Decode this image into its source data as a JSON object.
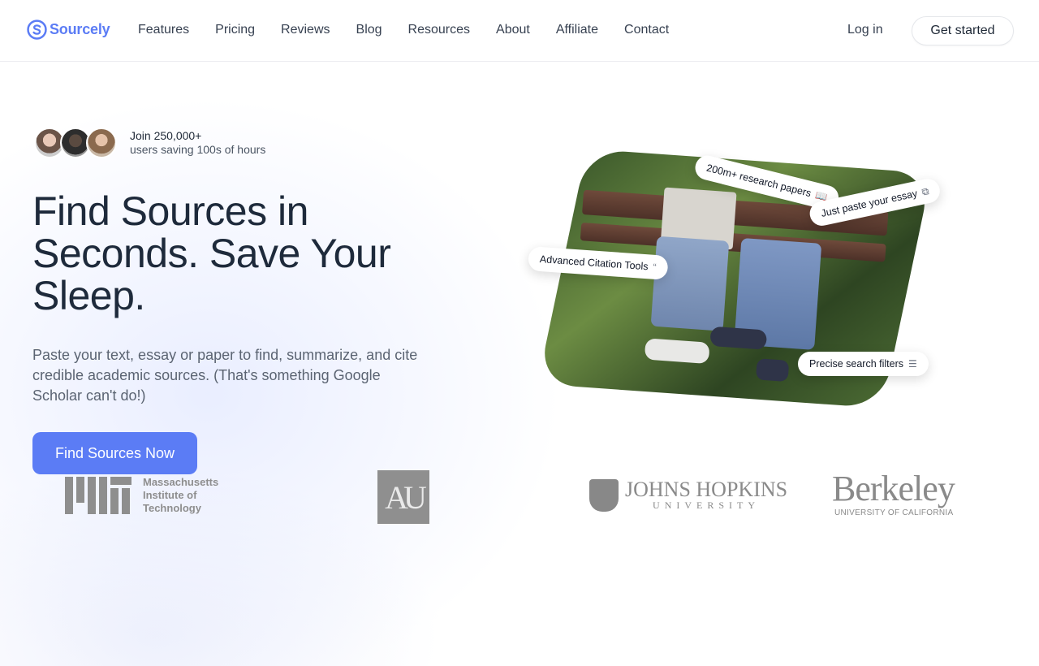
{
  "nav": {
    "brand": "Sourcely",
    "links": [
      "Features",
      "Pricing",
      "Reviews",
      "Blog",
      "Resources",
      "About",
      "Affiliate",
      "Contact"
    ],
    "login": "Log in",
    "get_started": "Get started"
  },
  "hero": {
    "social_proof_line1": "Join 250,000+",
    "social_proof_line2": "users saving 100s of hours",
    "headline": "Find Sources in Seconds. Save Your Sleep.",
    "subheadline": "Paste your text, essay or paper to find, summarize, and cite credible academic sources. (That's something Google Scholar can't do!)",
    "cta": "Find Sources Now",
    "tags": {
      "research_papers": "200m+ research papers",
      "paste_essay": "Just paste your essay",
      "citation_tools": "Advanced Citation Tools",
      "search_filters": "Precise search filters"
    }
  },
  "logos": {
    "mit_line1": "Massachusetts",
    "mit_line2": "Institute of",
    "mit_line3": "Technology",
    "au": "AU",
    "jhu_line1": "JOHNS HOPKINS",
    "jhu_line2": "UNIVERSITY",
    "berkeley_line1": "Berkeley",
    "berkeley_line2": "UNIVERSITY OF CALIFORNIA"
  },
  "colors": {
    "accent": "#5b7cf5",
    "logo_gray": "#8e8e8e"
  }
}
